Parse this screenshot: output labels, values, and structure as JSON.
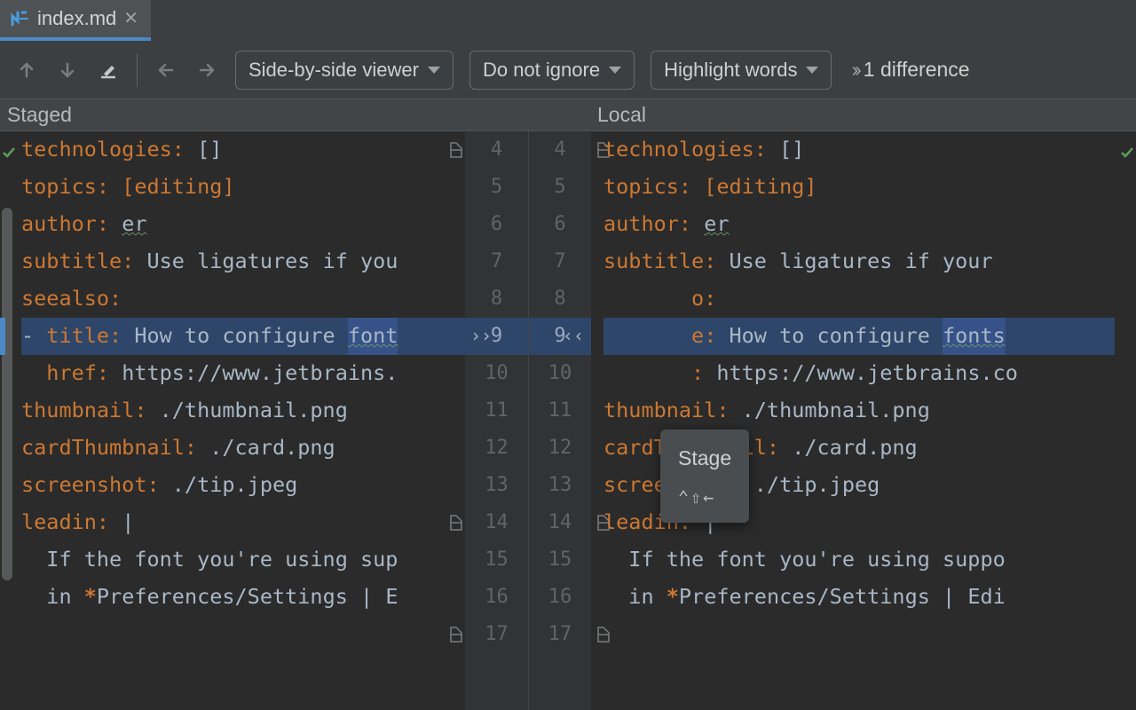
{
  "tab": {
    "filename": "index.md"
  },
  "toolbar": {
    "viewer_mode": "Side-by-side viewer",
    "ignore_mode": "Do not ignore",
    "highlight_mode": "Highlight words",
    "diff_count_label": "1 difference"
  },
  "headers": {
    "left": "Staged",
    "right": "Local"
  },
  "tooltip": {
    "label": "Stage",
    "shortcut": "⌃⇧←"
  },
  "gutter": {
    "rows": [
      4,
      5,
      6,
      7,
      8,
      9,
      10,
      11,
      12,
      13,
      14,
      15,
      16,
      17
    ]
  },
  "left_lines": [
    {
      "key": "technologies:",
      "rest": " []"
    },
    {
      "key": "topics:",
      "rest_orange": " [editing]"
    },
    {
      "key": "author:",
      "rest": " er",
      "wavy": true
    },
    {
      "key": "subtitle:",
      "rest": " Use ligatures if you"
    },
    {
      "key": "seealso:",
      "rest": ""
    },
    {
      "prefix": "- ",
      "key": "title:",
      "rest": " How to configure ",
      "hl": "font",
      "mod": true
    },
    {
      "indent": "  ",
      "key": "href:",
      "rest": " https://www.jetbrains."
    },
    {
      "key": "thumbnail:",
      "rest": " ./thumbnail.png"
    },
    {
      "key": "cardThumbnail:",
      "rest": " ./card.png"
    },
    {
      "key": "screenshot:",
      "rest": " ./tip.jpeg"
    },
    {
      "key": "leadin:",
      "rest": " |"
    },
    {
      "indent": "  ",
      "text": "If the font you're using sup"
    },
    {
      "indent": "  ",
      "text_pre": "in ",
      "star": "*",
      "text_post": "Preferences/Settings | E"
    }
  ],
  "right_lines": [
    {
      "key": "technologies:",
      "rest": " []"
    },
    {
      "key": "topics:",
      "rest_orange": " [editing]"
    },
    {
      "key": "author:",
      "rest": " er",
      "wavy": true
    },
    {
      "key": "subtitle:",
      "rest": " Use ligatures if your "
    },
    {
      "key": "       o:",
      "rest": "",
      "keyvis": "o:"
    },
    {
      "indent": "       ",
      "key": "e:",
      "rest": " How to configure ",
      "hl": "fonts",
      "mod": true
    },
    {
      "indent": "       ",
      "key": ":",
      "rest": " https://www.jetbrains.co"
    },
    {
      "key": "thumbnail:",
      "rest": " ./thumbnail.png"
    },
    {
      "key": "cardThumbnail:",
      "rest": " ./card.png"
    },
    {
      "key": "screenshot:",
      "rest": " ./tip.jpeg"
    },
    {
      "key": "leadin:",
      "rest": " |"
    },
    {
      "indent": "  ",
      "text": "If the font you're using suppo"
    },
    {
      "indent": "  ",
      "text_pre": "in ",
      "star": "*",
      "text_post": "Preferences/Settings | Edi"
    }
  ]
}
